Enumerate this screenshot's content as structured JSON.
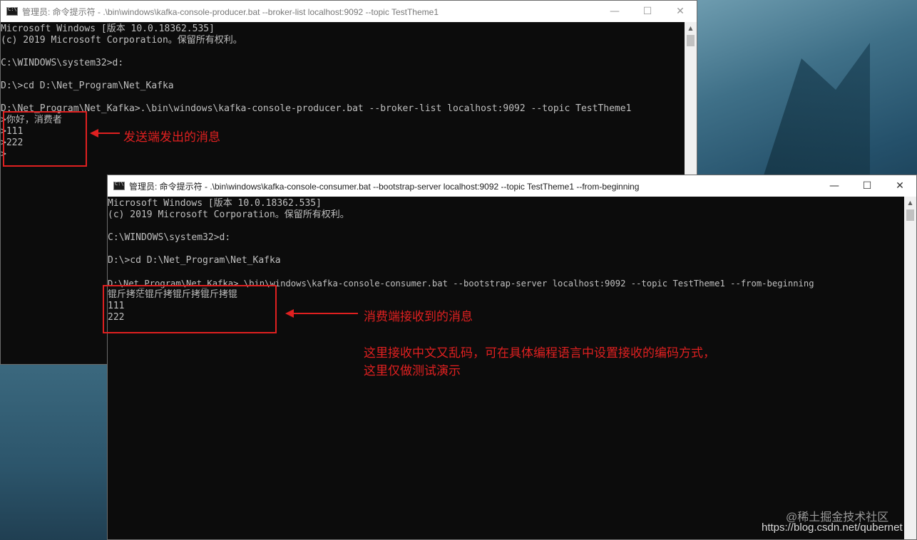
{
  "producer_window": {
    "title": "管理员: 命令提示符 - .\\bin\\windows\\kafka-console-producer.bat  --broker-list localhost:9092 --topic TestTheme1",
    "controls": {
      "minimize": "—",
      "maximize": "☐",
      "close": "✕"
    },
    "lines": [
      "Microsoft Windows [版本 10.0.18362.535]",
      "(c) 2019 Microsoft Corporation。保留所有权利。",
      "",
      "C:\\WINDOWS\\system32>d:",
      "",
      "D:\\>cd D:\\Net_Program\\Net_Kafka",
      "",
      "D:\\Net_Program\\Net_Kafka>.\\bin\\windows\\kafka-console-producer.bat --broker-list localhost:9092 --topic TestTheme1",
      ">你好，消费者",
      ">111",
      ">222",
      ">"
    ]
  },
  "consumer_window": {
    "title": "管理员: 命令提示符 - .\\bin\\windows\\kafka-console-consumer.bat  --bootstrap-server localhost:9092 --topic TestTheme1 --from-beginning",
    "controls": {
      "minimize": "—",
      "maximize": "☐",
      "close": "✕"
    },
    "lines": [
      "Microsoft Windows [版本 10.0.18362.535]",
      "(c) 2019 Microsoft Corporation。保留所有权利。",
      "",
      "C:\\WINDOWS\\system32>d:",
      "",
      "D:\\>cd D:\\Net_Program\\Net_Kafka",
      "",
      "D:\\Net_Program\\Net_Kafka>.\\bin\\windows\\kafka-console-consumer.bat --bootstrap-server localhost:9092 --topic TestTheme1 --from-beginning",
      "锟斤拷茫锟斤拷锟斤拷锟斤拷锟",
      "111",
      "222"
    ]
  },
  "annotations": {
    "producer_label": "发送端发出的消息",
    "consumer_label": "消费端接收到的消息",
    "note_line1": "这里接收中文又乱码，可在具体编程语言中设置接收的编码方式，",
    "note_line2": "这里仅做测试演示"
  },
  "watermark": {
    "site": "@稀土掘金技术社区",
    "url": "https://blog.csdn.net/qubernet"
  },
  "colors": {
    "annotation": "#e02020",
    "console_bg": "#0c0c0c",
    "console_text": "#c0c0c0"
  }
}
